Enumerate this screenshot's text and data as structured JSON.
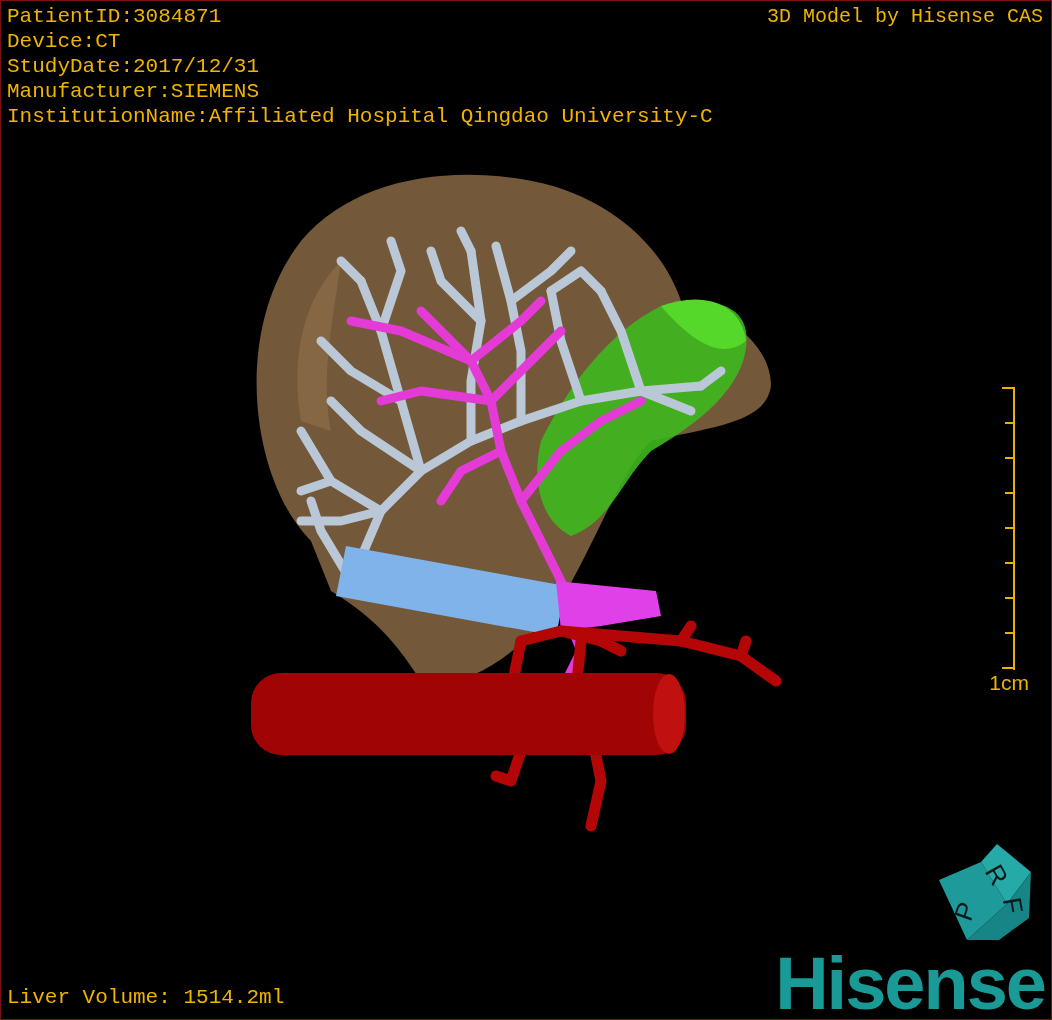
{
  "info_lines": [
    "PatientID:3084871",
    "Device:CT",
    "StudyDate:2017/12/31",
    "Manufacturer:SIEMENS",
    "InstitutionName:Affiliated Hospital Qingdao University-C"
  ],
  "model_credit": "3D Model by Hisense CAS",
  "scale_bar": {
    "label": "1cm"
  },
  "orientation_cube": {
    "faces": [
      "P",
      "R",
      "F"
    ]
  },
  "liver_volume": "Liver Volume: 1514.2ml",
  "logo": "Hisense"
}
